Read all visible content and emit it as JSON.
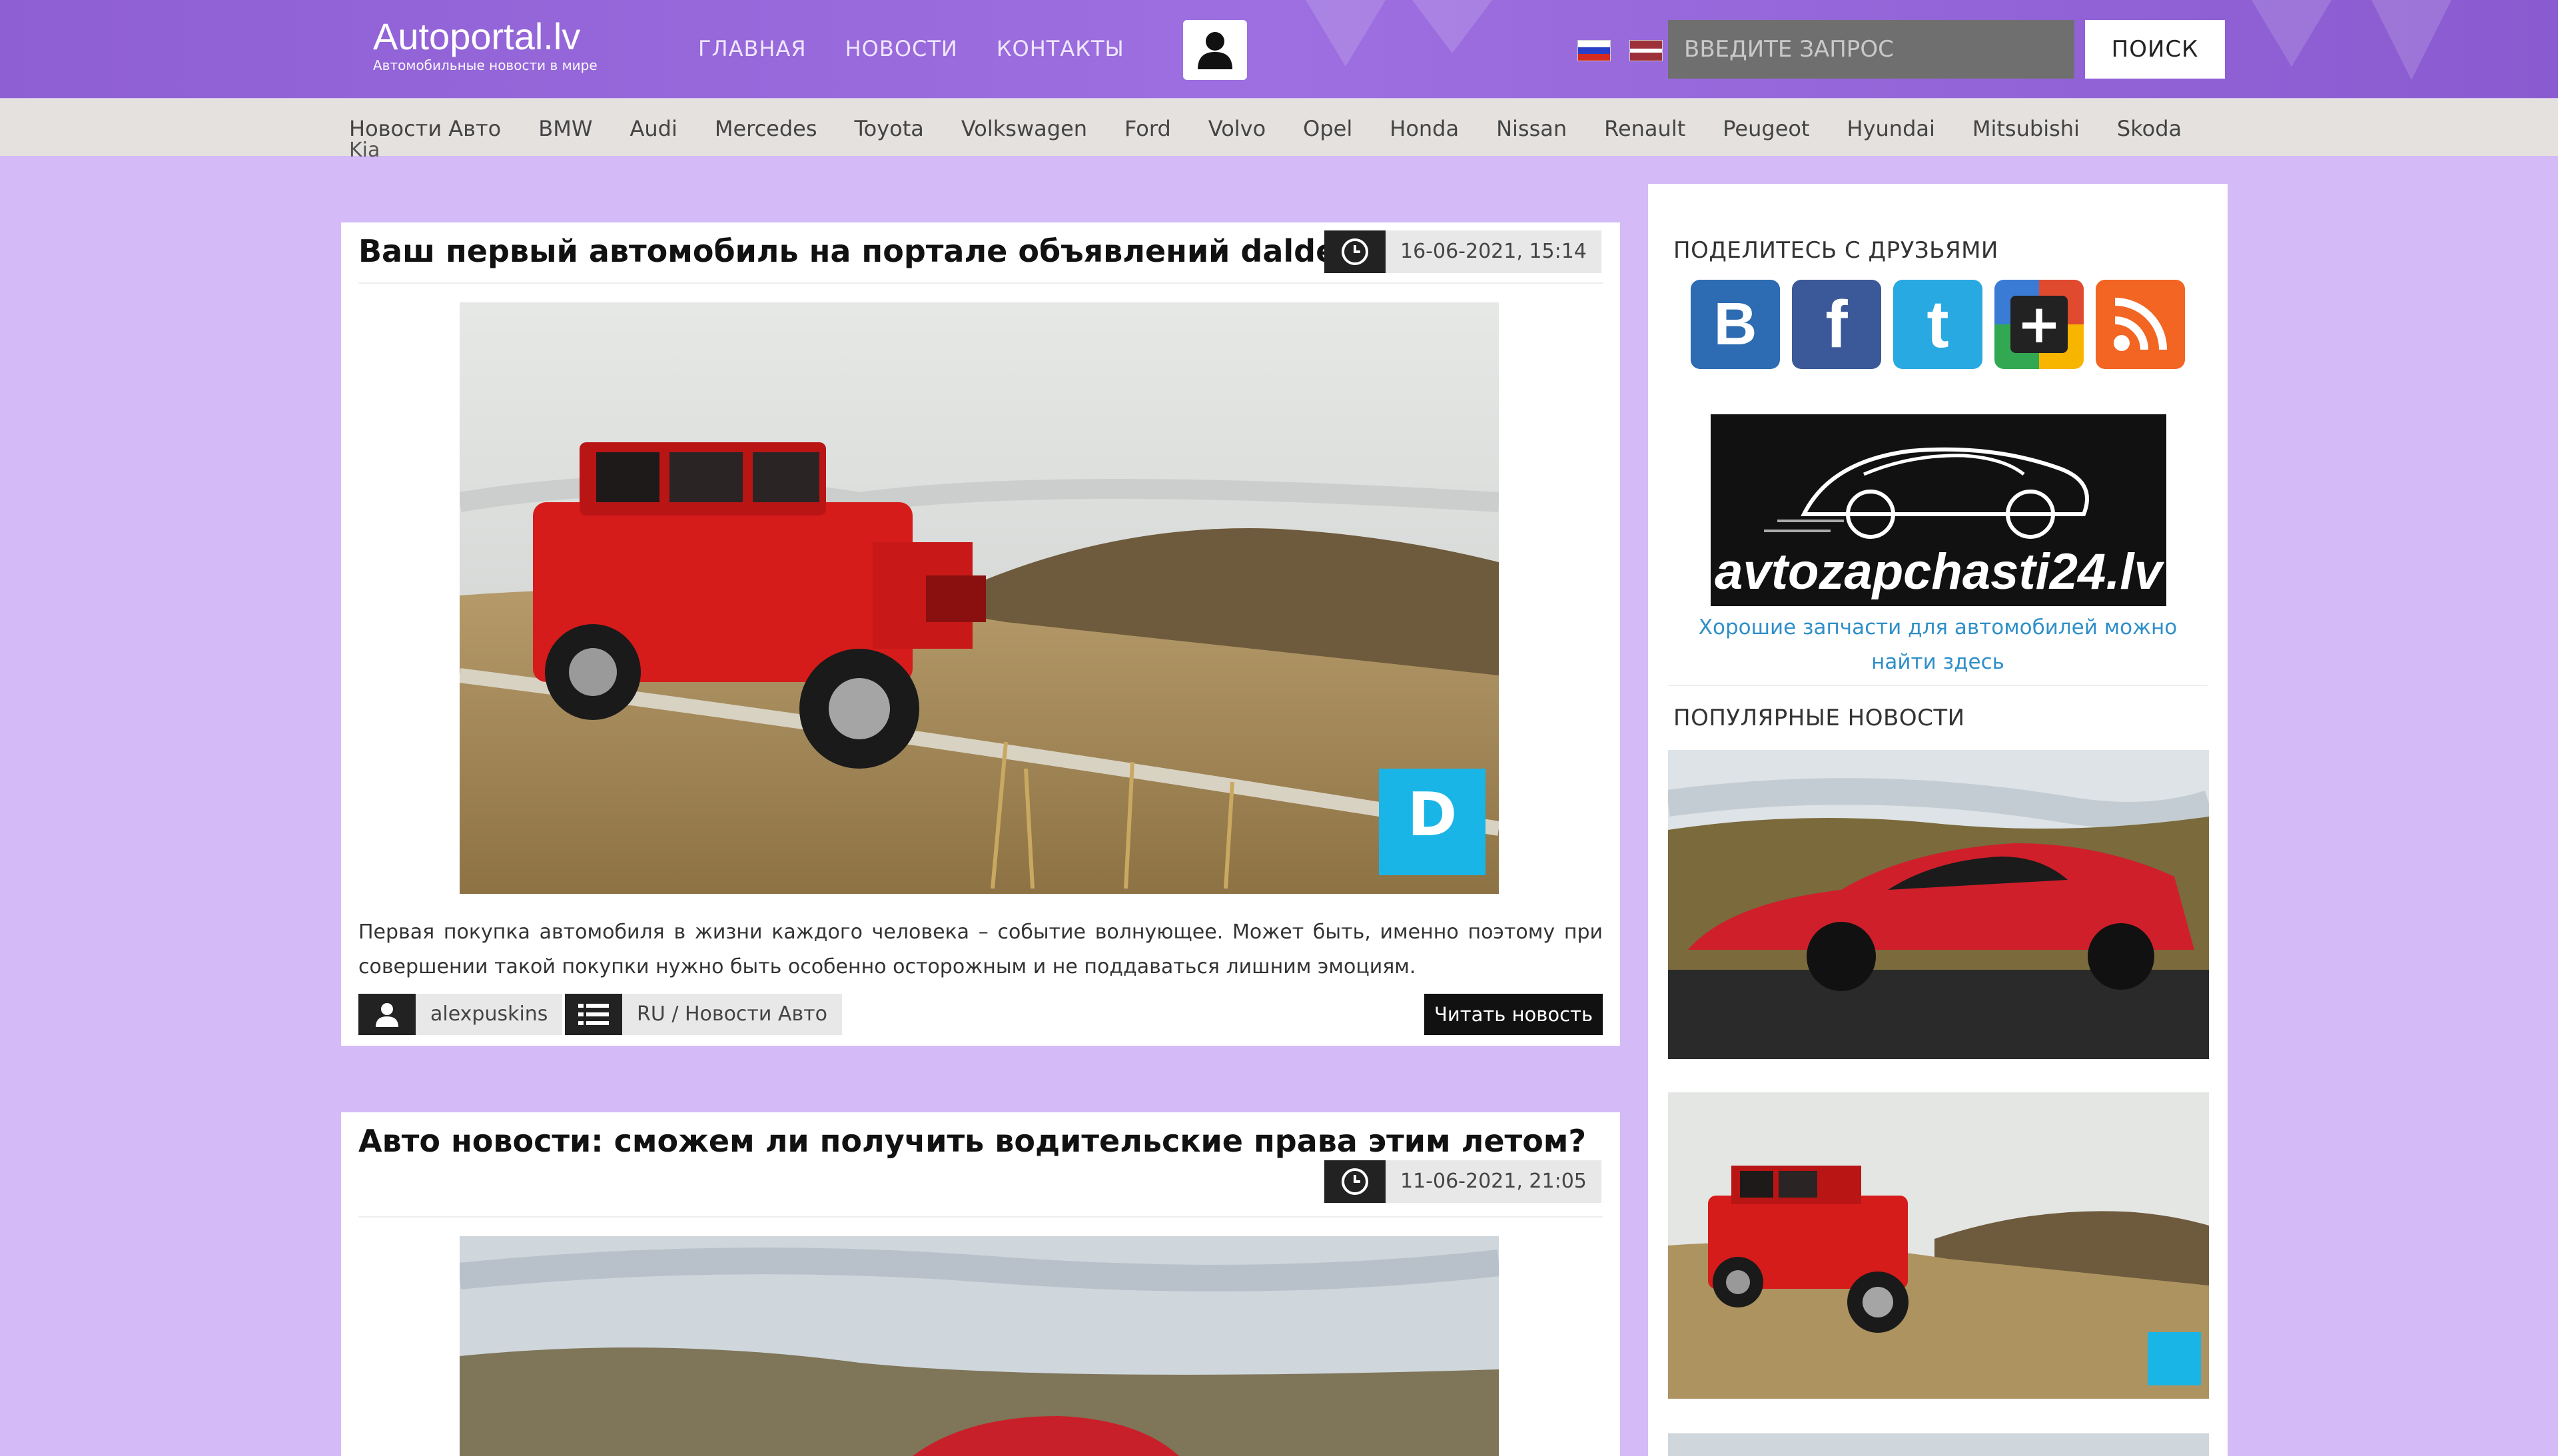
{
  "header": {
    "logo_title": "Autoportal.lv",
    "logo_subtitle": "Автомобильные новости в мире",
    "nav": [
      "ГЛАВНАЯ",
      "НОВОСТИ",
      "КОНТАКТЫ"
    ],
    "search_placeholder": "ВВЕДИТЕ ЗАПРОС",
    "search_button": "ПОИСК"
  },
  "brands": [
    "Новости Авто",
    "BMW",
    "Audi",
    "Mercedes",
    "Toyota",
    "Volkswagen",
    "Ford",
    "Volvo",
    "Opel",
    "Honda",
    "Nissan",
    "Renault",
    "Peugeot",
    "Hyundai",
    "Mitsubishi",
    "Skoda"
  ],
  "brands_overflow": "Kia",
  "articles": [
    {
      "title": "Ваш первый автомобиль на портале объявлений dalder.lv",
      "date": "16-06-2021, 15:14",
      "excerpt": "Первая покупка автомобиля в жизни каждого человека – событие волнующее. Может быть, именно поэтому при совершении такой покупки нужно быть особенно осторожным и не поддаваться лишним эмоциям.",
      "author": "alexpuskins",
      "category": "RU / Новости Авто",
      "read_more": "Читать новость"
    },
    {
      "title": "Авто новости: сможем ли получить водительские права этим летом?",
      "date": "11-06-2021, 21:05"
    }
  ],
  "sidebar": {
    "share_heading": "ПОДЕЛИТЕСЬ С ДРУЗЬЯМИ",
    "ad_text": "avtozapchasti24.lv",
    "ad_caption": "Хорошие запчасти для автомобилей можно найти здесь",
    "popular_heading": "ПОПУЛЯРНЫЕ НОВОСТИ"
  },
  "colors": {
    "page_bg": "#d4bbf7",
    "header": "#9566d9",
    "vk": "#2d6bb2",
    "facebook": "#3b5998",
    "twitter": "#29a9e1",
    "google_plus": "#e04b2f",
    "rss": "#f26522",
    "link": "#2f8fc9"
  }
}
